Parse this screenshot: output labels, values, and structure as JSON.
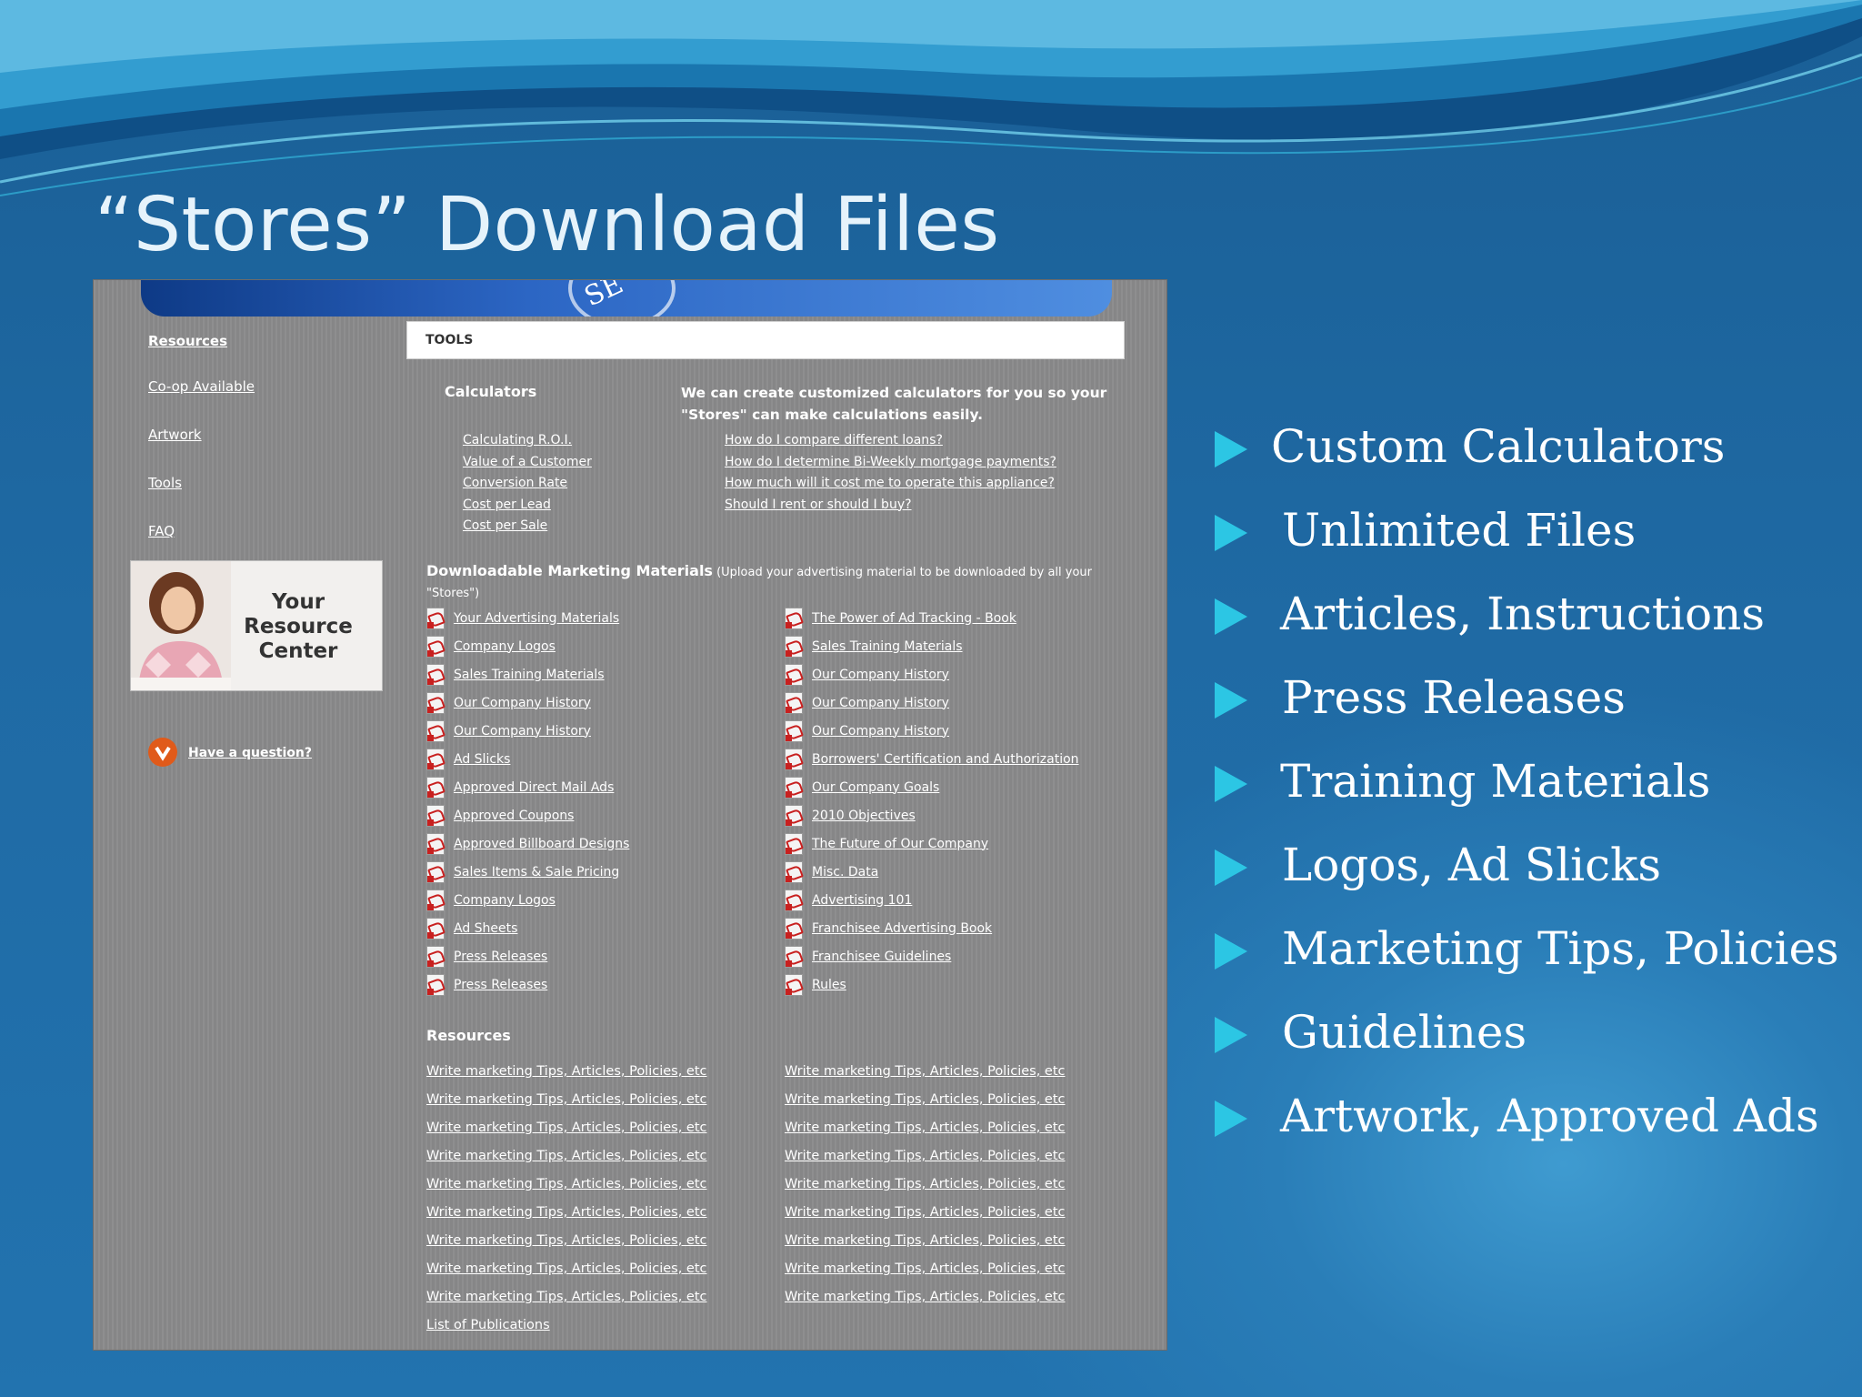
{
  "slide": {
    "title": "“Stores” Download Files",
    "colors": {
      "background": "#1f6aa4",
      "bullet_marker": "#2cc6e4",
      "title": "#e6f3fb"
    },
    "bullets": [
      "Custom Calculators",
      "Unlimited Files",
      "Articles, Instructions",
      "Press Releases",
      "Training Materials",
      "Logos, Ad Slicks",
      "Marketing Tips, Policies",
      "Guidelines",
      "Artwork, Approved Ads"
    ]
  },
  "screenshot": {
    "banner_text": "SE",
    "sidebar": {
      "links": [
        "Resources",
        "Co-op Available",
        "Artwork",
        "Tools",
        "FAQ"
      ],
      "promo_title": "Your Resource Center",
      "question_link": "Have a question?"
    },
    "tools_bar_label": "TOOLS",
    "calculators": {
      "heading": "Calculators",
      "description": "We can create customized calculators for you so your \"Stores\" can make calculations easily.",
      "left_links": [
        "Calculating R.O.I.",
        "Value of a Customer",
        "Conversion Rate",
        "Cost per Lead",
        "Cost per Sale"
      ],
      "right_links": [
        "How do I compare different loans?",
        "How do I determine Bi-Weekly mortgage payments?",
        "How much will it cost me to operate this appliance?",
        "Should I rent or should I buy?"
      ]
    },
    "downloads": {
      "heading": "Downloadable Marketing Materials",
      "note": "(Upload your advertising material to be downloaded by all your \"Stores\")",
      "icon": "pdf-file-icon",
      "left_files": [
        "Your Advertising Materials",
        "Company Logos",
        "Sales Training Materials",
        "Our Company History",
        "Our Company History",
        "Ad Slicks",
        "Approved Direct Mail Ads",
        "Approved Coupons",
        "Approved Billboard Designs",
        "Sales Items & Sale Pricing",
        "Company Logos",
        "Ad Sheets",
        "Press Releases",
        "Press Releases"
      ],
      "right_files": [
        "The Power of Ad Tracking - Book",
        "Sales Training Materials",
        "Our Company History",
        "Our Company History",
        "Our Company History",
        "Borrowers' Certification and Authorization",
        "Our Company Goals",
        "2010 Objectives",
        "The Future of Our Company",
        "Misc. Data",
        "Advertising 101",
        "Franchisee Advertising Book",
        "Franchisee Guidelines",
        "Rules"
      ]
    },
    "resources": {
      "heading": "Resources",
      "left_links": [
        "Write marketing Tips, Articles, Policies, etc",
        "Write marketing Tips, Articles, Policies, etc",
        "Write marketing Tips, Articles, Policies, etc",
        "Write marketing Tips, Articles, Policies, etc",
        "Write marketing Tips, Articles, Policies, etc",
        "Write marketing Tips, Articles, Policies, etc",
        "Write marketing Tips, Articles, Policies, etc",
        "Write marketing Tips, Articles, Policies, etc",
        "Write marketing Tips, Articles, Policies, etc",
        "List of Publications"
      ],
      "right_links": [
        "Write marketing Tips, Articles, Policies, etc",
        "Write marketing Tips, Articles, Policies, etc",
        "Write marketing Tips, Articles, Policies, etc",
        "Write marketing Tips, Articles, Policies, etc",
        "Write marketing Tips, Articles, Policies, etc",
        "Write marketing Tips, Articles, Policies, etc",
        "Write marketing Tips, Articles, Policies, etc",
        "Write marketing Tips, Articles, Policies, etc",
        "Write marketing Tips, Articles, Policies, etc"
      ]
    }
  }
}
